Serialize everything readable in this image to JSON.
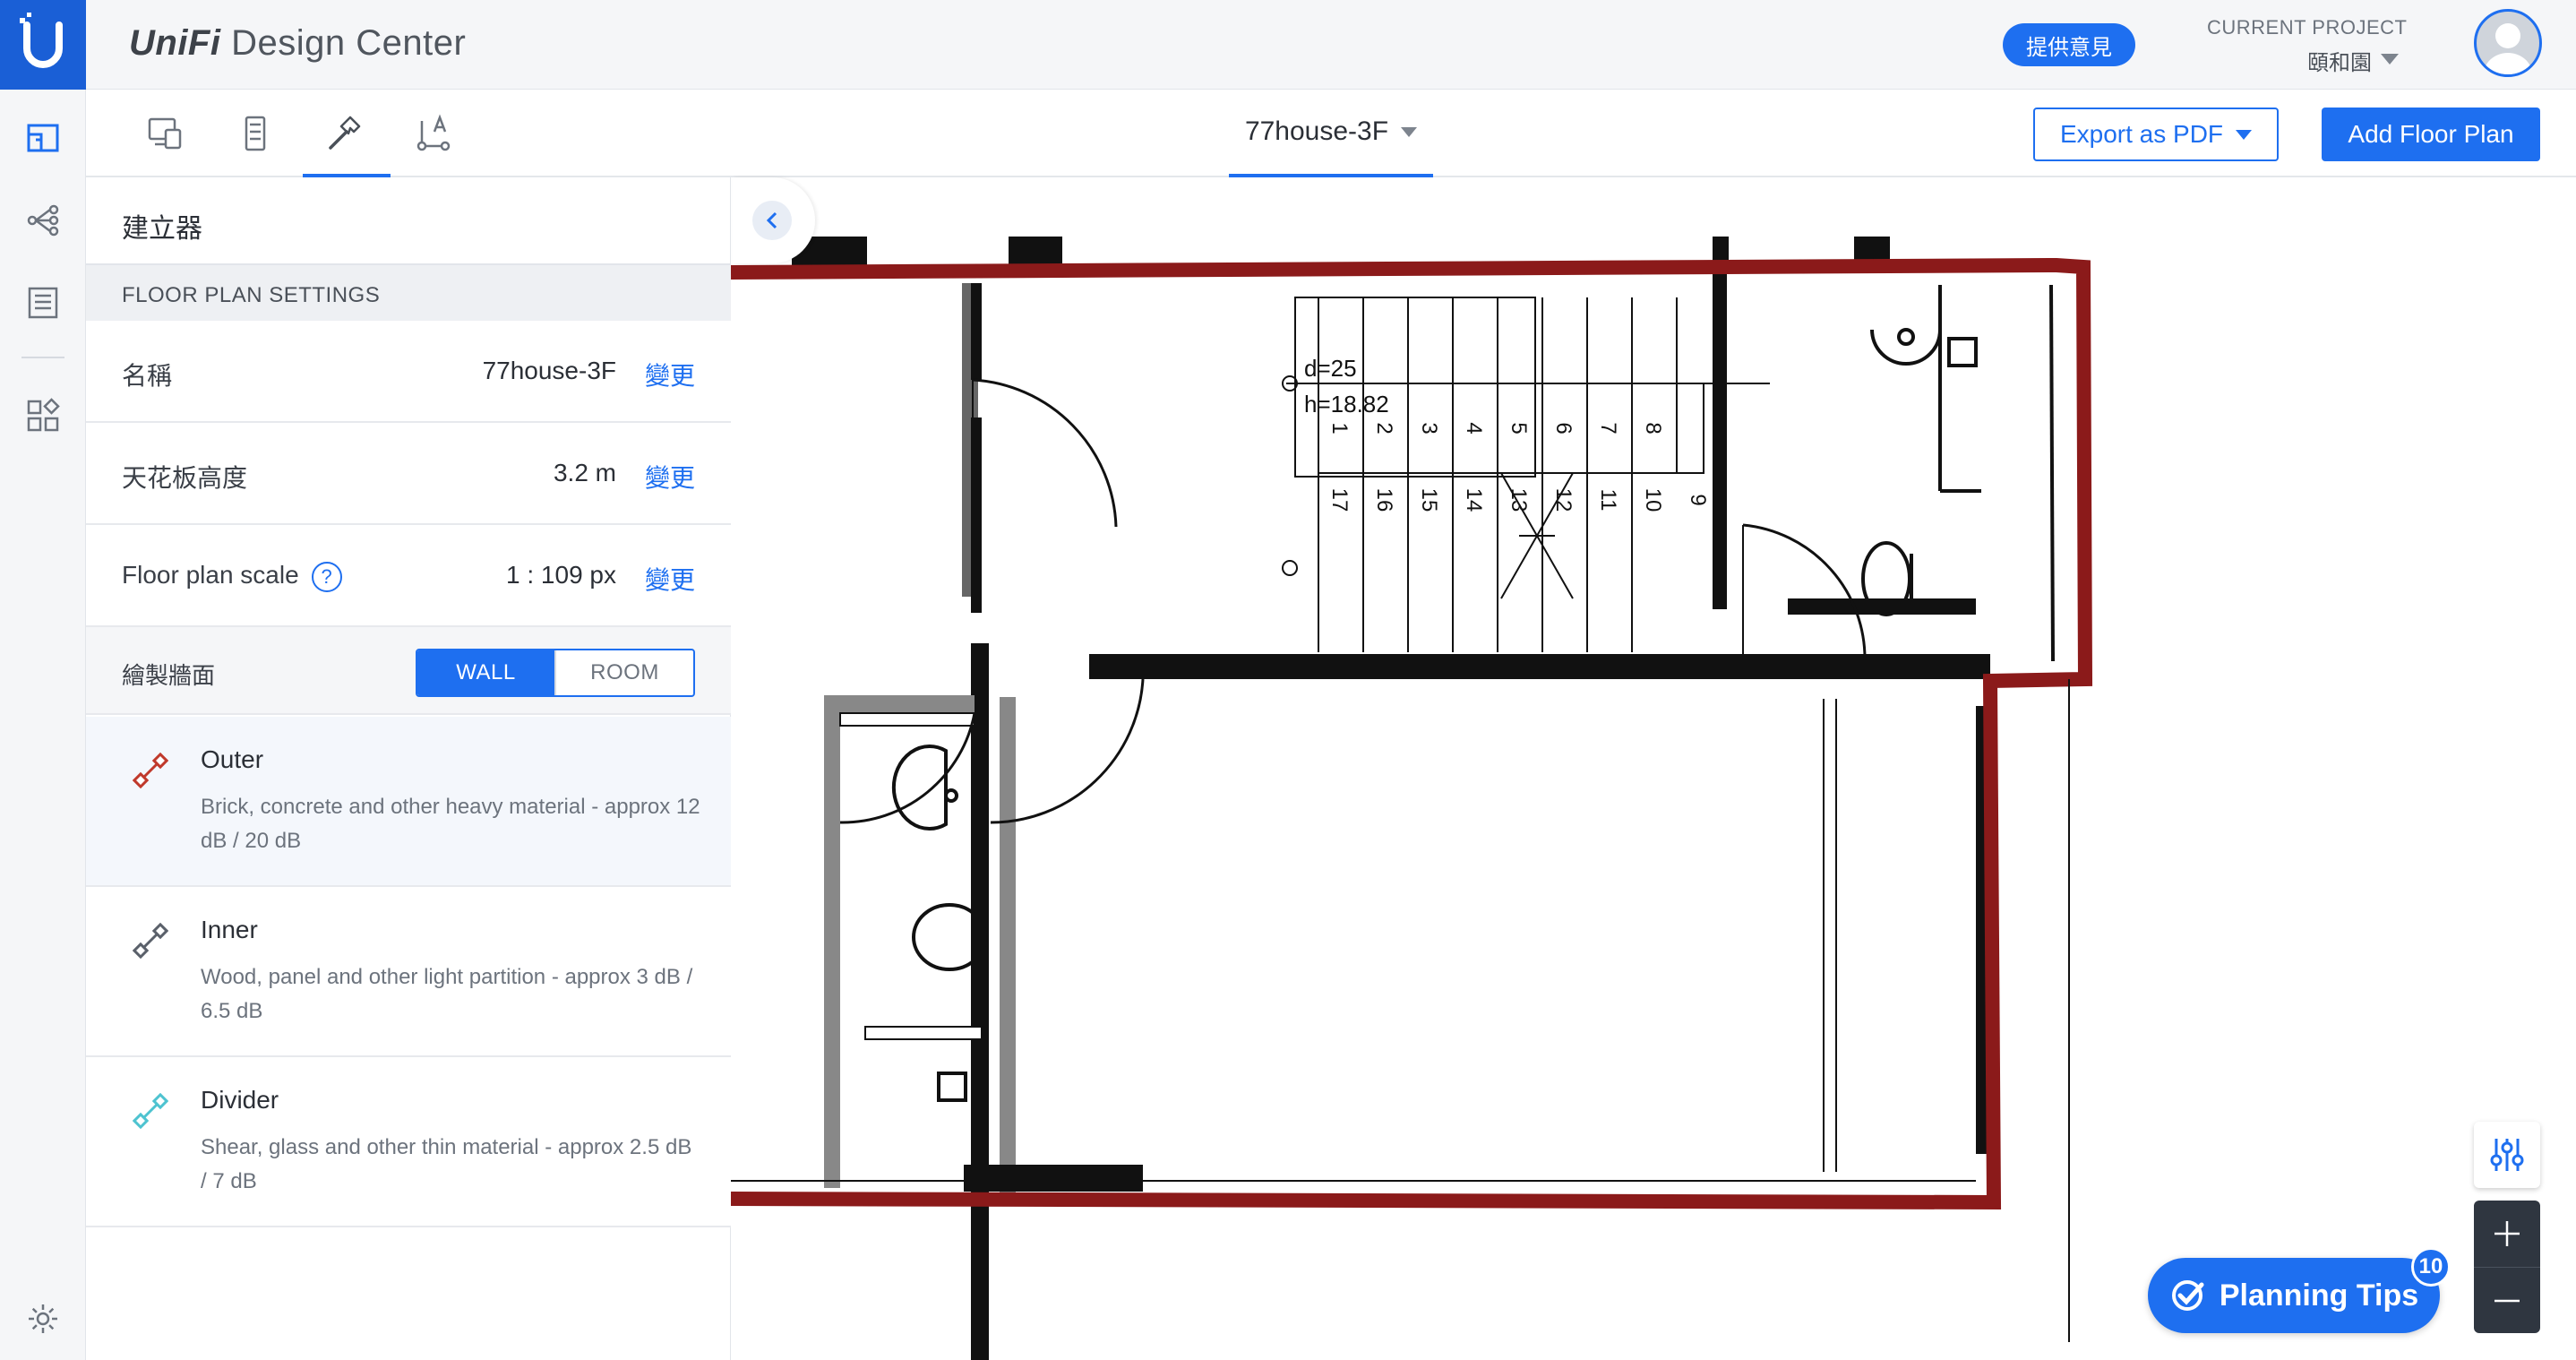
{
  "app": {
    "brand_main": "UniFi",
    "brand_sub": " Design Center",
    "feedback_label": "提供意見",
    "project_label": "CURRENT PROJECT",
    "project_name": "頤和園"
  },
  "toolbar": {
    "tabs": [
      {
        "name": "devices",
        "icon": "devices-icon"
      },
      {
        "name": "rack",
        "icon": "rack-icon"
      },
      {
        "name": "builder",
        "icon": "hammer-icon",
        "active": true
      },
      {
        "name": "measure",
        "icon": "measure-icon"
      }
    ],
    "floor_name": "77house-3F",
    "export_label": "Export as PDF",
    "add_floor_label": "Add Floor Plan"
  },
  "panel": {
    "title": "建立器",
    "section_title": "FLOOR PLAN SETTINGS",
    "settings": [
      {
        "label": "名稱",
        "value": "77house-3F",
        "action": "變更"
      },
      {
        "label": "天花板高度",
        "value": "3.2 m",
        "action": "變更"
      },
      {
        "label": "Floor plan scale",
        "value": "1 : 109 px",
        "action": "變更",
        "help": "?"
      }
    ],
    "draw_label": "繪製牆面",
    "mode_wall": "WALL",
    "mode_room": "ROOM",
    "walls": [
      {
        "name": "Outer",
        "desc": "Brick, concrete and other heavy material - approx 12 dB / 20 dB",
        "color": "#c0392b",
        "active": true
      },
      {
        "name": "Inner",
        "desc": "Wood, panel and other light partition - approx 3 dB / 6.5 dB",
        "color": "#5a606a"
      },
      {
        "name": "Divider",
        "desc": "Shear, glass and other thin material - approx 2.5 dB / 7 dB",
        "color": "#4ec3d0"
      }
    ]
  },
  "floorplan": {
    "stair_labels": [
      "1",
      "2",
      "3",
      "4",
      "5",
      "6",
      "7",
      "8",
      "17",
      "16",
      "15",
      "14",
      "13",
      "12",
      "11",
      "10",
      "9"
    ],
    "stair_note_1": "d=25",
    "stair_note_2": "h=18.82",
    "wall_color": "#8b1a1a"
  },
  "canvas_controls": {
    "tips_label": "Planning Tips",
    "tips_count": "10"
  }
}
